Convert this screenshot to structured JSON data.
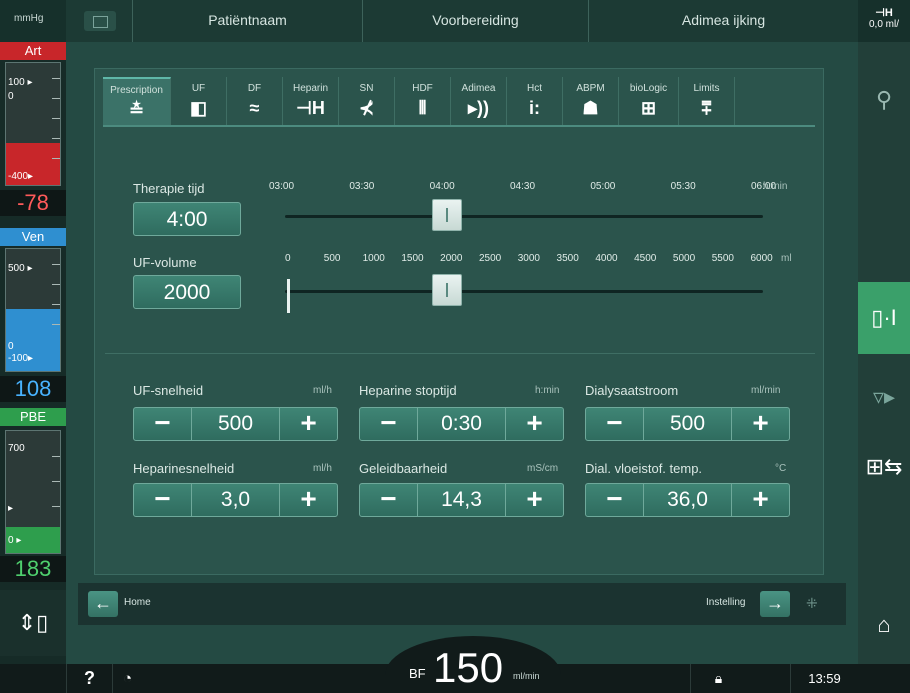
{
  "left": {
    "units": "mmHg",
    "art": {
      "title": "Art",
      "upper": "100 ▸",
      "zero": "0",
      "lower": "-400▸",
      "value": "-78",
      "color": "#c8262a"
    },
    "ven": {
      "title": "Ven",
      "upper": "500 ▸",
      "zero": "0",
      "lower": "-100▸",
      "value": "108",
      "color": "#2f8fd0"
    },
    "pbe": {
      "title": "PBE",
      "upper": "700",
      "mid": "▸",
      "zero": "0 ▸",
      "value": "183",
      "color": "#2e9e4d"
    }
  },
  "header": {
    "tabs": [
      "Patiëntnaam",
      "Voorbereiding",
      "Adimea ijking"
    ],
    "heparin_readout": "0,0 ml/"
  },
  "panel_tabs": [
    {
      "label": "Prescription",
      "icon": "≛"
    },
    {
      "label": "UF",
      "icon": "◧"
    },
    {
      "label": "DF",
      "icon": "≈"
    },
    {
      "label": "Heparin",
      "icon": "⊣H"
    },
    {
      "label": "SN",
      "icon": "⊀"
    },
    {
      "label": "HDF",
      "icon": "⫴"
    },
    {
      "label": "Adimea",
      "icon": "▸))"
    },
    {
      "label": "Hct",
      "icon": "i:"
    },
    {
      "label": "ABPM",
      "icon": "☗"
    },
    {
      "label": "bioLogic",
      "icon": "⊞"
    },
    {
      "label": "Limits",
      "icon": "⩱"
    }
  ],
  "therapy": {
    "label": "Therapie tijd",
    "value": "4:00",
    "value_hours": 4.0,
    "unit": "h:min",
    "scale": [
      "03:00",
      "03:30",
      "04:00",
      "04:30",
      "05:00",
      "05:30",
      "06:00"
    ]
  },
  "ufvol": {
    "label": "UF-volume",
    "value": "2000",
    "value_ml": 2000,
    "unit": "ml",
    "scale": [
      "0",
      "500",
      "1000",
      "1500",
      "2000",
      "2500",
      "3000",
      "3500",
      "4000",
      "4500",
      "5000",
      "5500",
      "6000"
    ]
  },
  "controls": [
    {
      "label": "UF-snelheid",
      "unit": "ml/h",
      "value": "500"
    },
    {
      "label": "Heparine stoptijd",
      "unit": "h:min",
      "value": "0:30"
    },
    {
      "label": "Dialysaatstroom",
      "unit": "ml/min",
      "value": "500"
    },
    {
      "label": "Heparinesnelheid",
      "unit": "ml/h",
      "value": "3,0"
    },
    {
      "label": "Geleidbaarheid",
      "unit": "mS/cm",
      "value": "14,3"
    },
    {
      "label": "Dial. vloeistof. temp.",
      "unit": "°C",
      "value": "36,0"
    }
  ],
  "stepper": {
    "minus": "−",
    "plus": "+"
  },
  "nav": {
    "home": "Home",
    "setting": "Instelling",
    "back_icon": "←",
    "fwd_icon": "→"
  },
  "status": {
    "help": "?",
    "bf_label": "BF",
    "bf_value": "150",
    "bf_unit": "ml/min",
    "time": "13:59"
  }
}
